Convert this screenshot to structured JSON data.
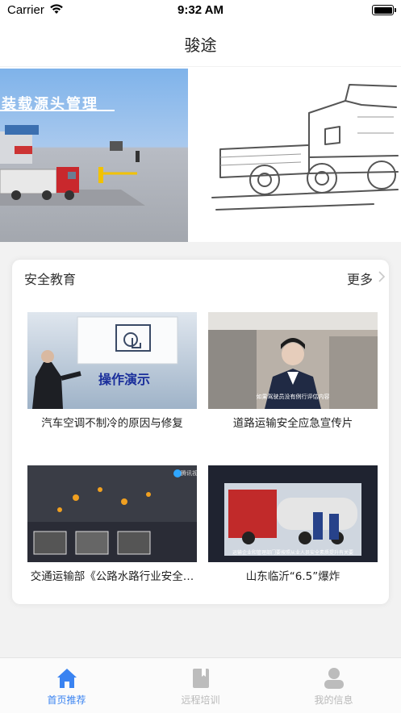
{
  "status_bar": {
    "carrier": "Carrier",
    "time": "9:32 AM"
  },
  "nav": {
    "title": "骏途"
  },
  "banner": {
    "slide1_caption": "装载源头管理",
    "active_index": 1,
    "count": 2
  },
  "safety_section": {
    "title": "安全教育",
    "more_label": "更多",
    "videos": [
      {
        "title": "汽车空调不制冷的原因与修复",
        "thumb_text": "操作演示"
      },
      {
        "title": "道路运输安全应急宣传片",
        "thumb_text": "如果驾驶员没有例行评估内容"
      },
      {
        "title": "交通运输部《公路水路行业安全…",
        "thumb_text": "腾讯视频"
      },
      {
        "title": "山东临沂“6.5”爆炸",
        "thumb_text": "运输企业和管理部门要按照从业人员安全素质提升有关要求,强化驾驶"
      }
    ]
  },
  "tabs": [
    {
      "label": "首页推荐",
      "icon": "home-icon",
      "active": true
    },
    {
      "label": "远程培训",
      "icon": "book-icon",
      "active": false
    },
    {
      "label": "我的信息",
      "icon": "person-icon",
      "active": false
    }
  ],
  "colors": {
    "accent": "#3a83f1",
    "inactive": "#b9b9b9"
  }
}
